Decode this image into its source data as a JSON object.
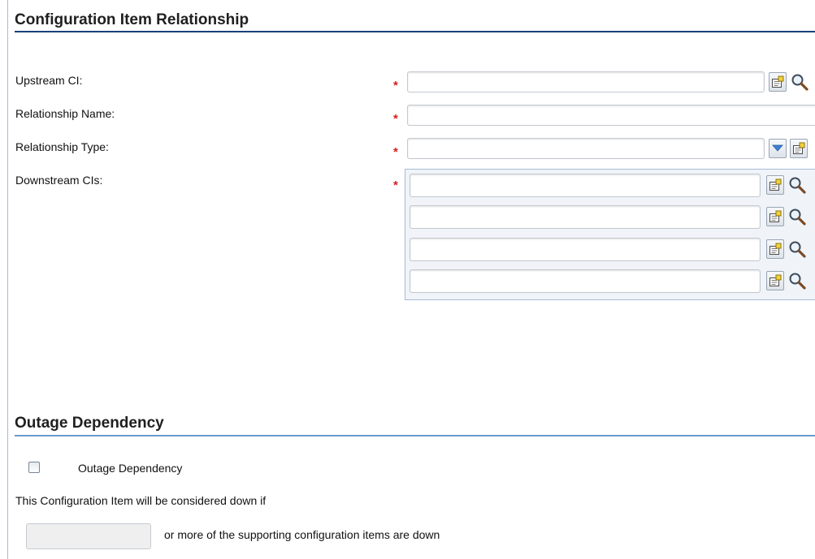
{
  "relationship_section": {
    "title": "Configuration Item Relationship",
    "upstream_label": "Upstream CI:",
    "name_label": "Relationship Name:",
    "type_label": "Relationship Type:",
    "downstream_label": "Downstream CIs:",
    "required_marker": "*",
    "upstream_value": "",
    "name_value": "",
    "type_value": "",
    "downstream_values": [
      "",
      "",
      "",
      ""
    ]
  },
  "outage_section": {
    "title": "Outage Dependency",
    "checkbox_label": "Outage Dependency",
    "checkbox_checked": false,
    "description": "This Configuration Item will be considered down if",
    "count_value": "",
    "count_suffix": "or more of the supporting configuration items are down"
  },
  "icons": [
    "fill-form-icon",
    "search-icon",
    "dropdown-arrow-icon"
  ],
  "colors": {
    "section_rule": "#17407a",
    "required": "#d21f1f",
    "panel_border": "#a9bbd6"
  }
}
